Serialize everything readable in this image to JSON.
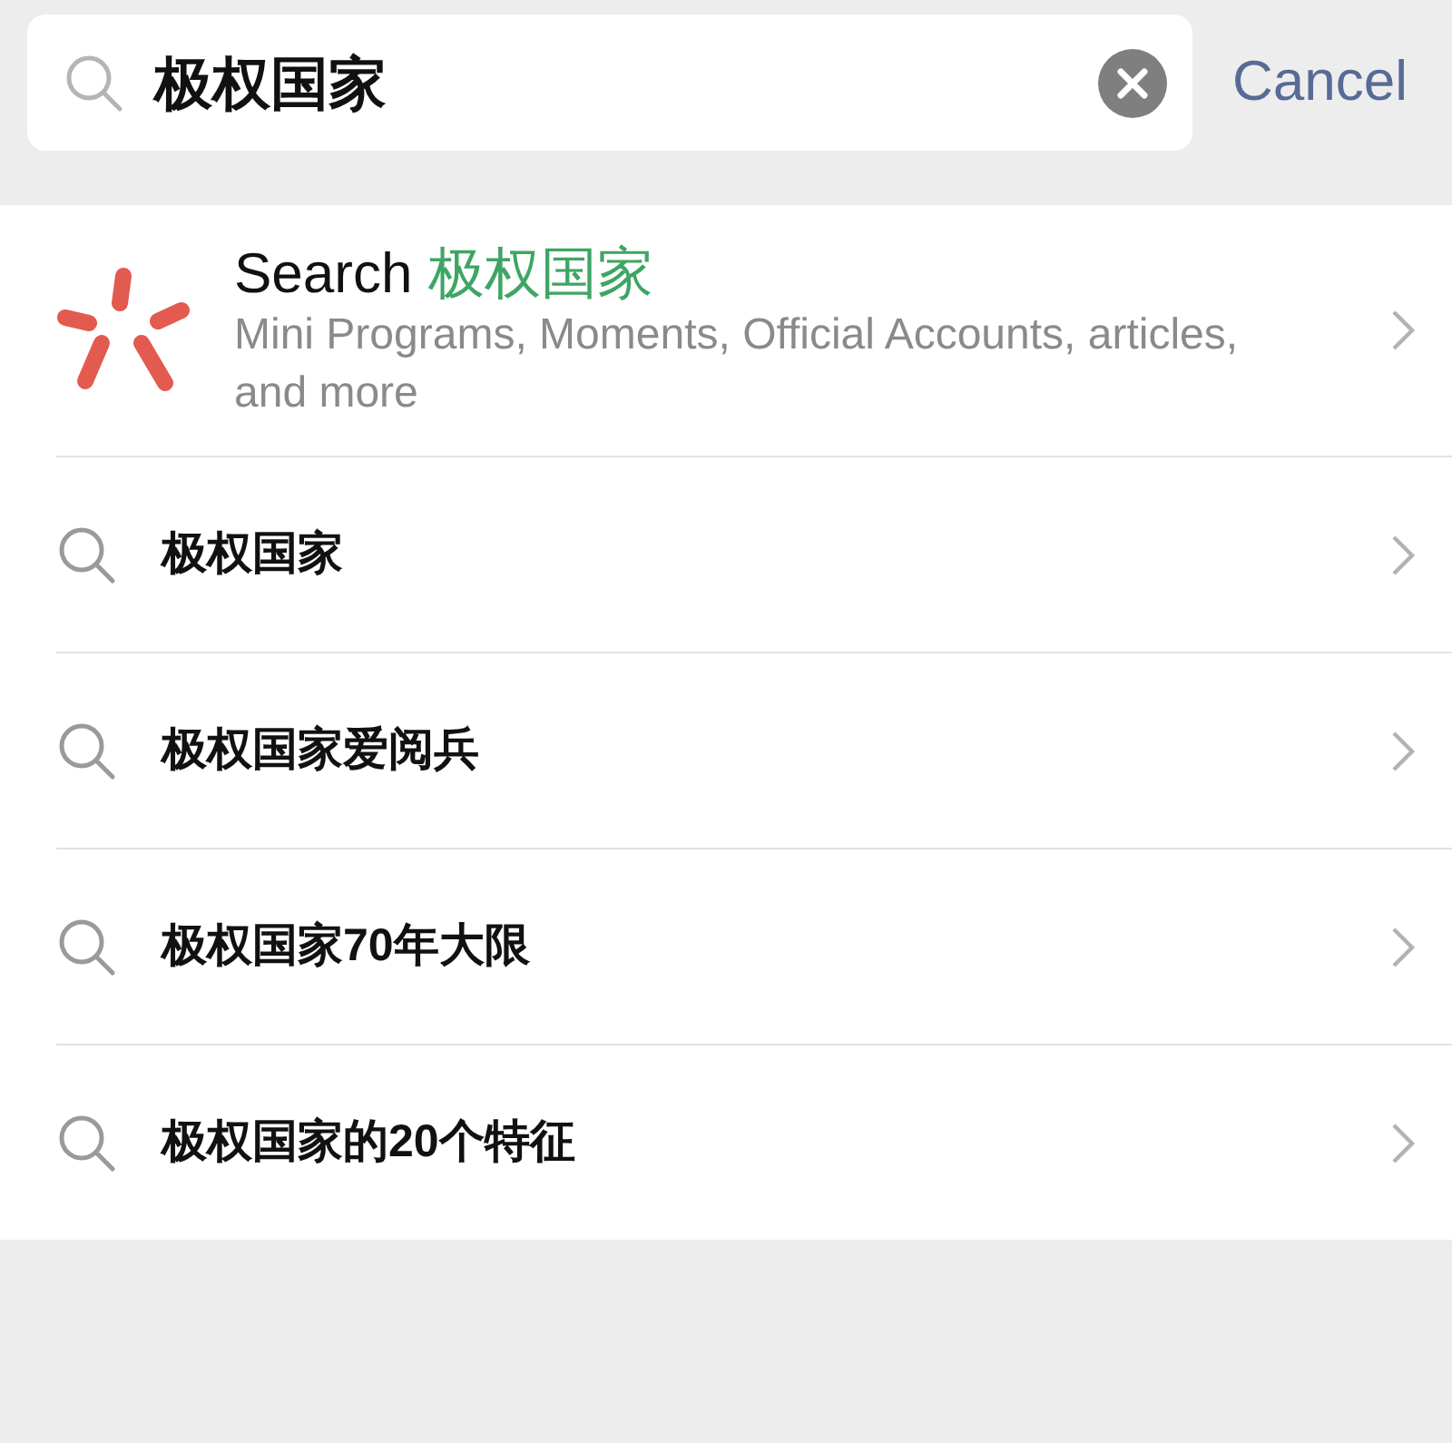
{
  "search": {
    "value": "极权国家"
  },
  "cancel": "Cancel",
  "search_all": {
    "prefix": "Search",
    "query": "极权国家",
    "description": "Mini Programs, Moments, Official Accounts, articles, and more"
  },
  "suggestions": [
    {
      "text": "极权国家"
    },
    {
      "text": "极权国家爱阅兵"
    },
    {
      "text": "极权国家70年大限"
    },
    {
      "text": "极权国家的20个特征"
    }
  ]
}
